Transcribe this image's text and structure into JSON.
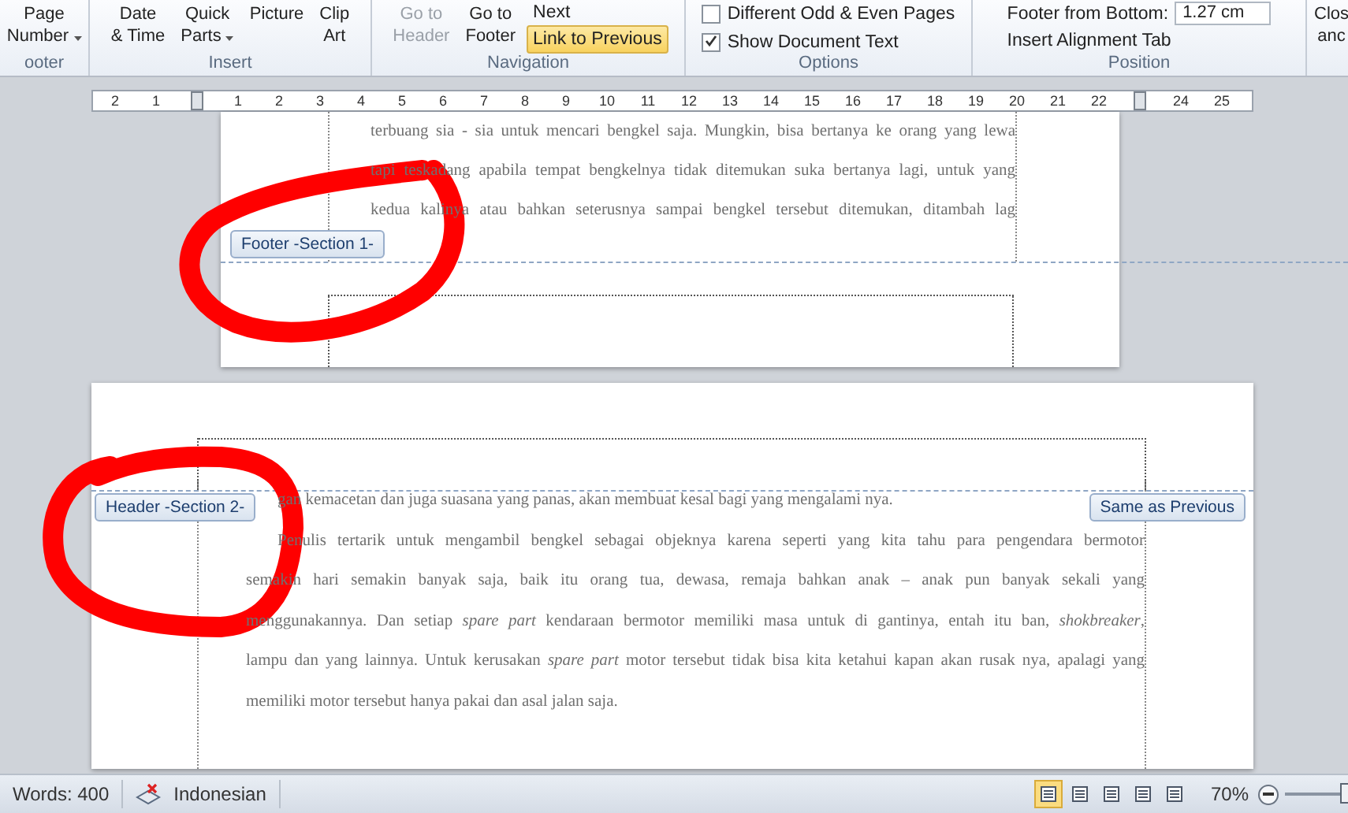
{
  "ribbon": {
    "groups": [
      {
        "label": "ooter",
        "items": [
          {
            "kind": "large",
            "lines": [
              "Page",
              "Number"
            ],
            "dropdown": true,
            "disabled": false
          }
        ]
      },
      {
        "label": "Insert",
        "items": [
          {
            "kind": "large",
            "lines": [
              "Date",
              "& Time"
            ],
            "dropdown": false,
            "disabled": false
          },
          {
            "kind": "large",
            "lines": [
              "Quick",
              "Parts"
            ],
            "dropdown": true,
            "disabled": false
          },
          {
            "kind": "large",
            "lines": [
              "Picture"
            ],
            "dropdown": false,
            "disabled": false
          },
          {
            "kind": "large",
            "lines": [
              "Clip",
              "Art"
            ],
            "dropdown": false,
            "disabled": false
          }
        ]
      },
      {
        "label": "Navigation",
        "items": [
          {
            "kind": "large",
            "lines": [
              "Go to",
              "Header"
            ],
            "dropdown": false,
            "disabled": true
          },
          {
            "kind": "large",
            "lines": [
              "Go to",
              "Footer"
            ],
            "dropdown": false,
            "disabled": false
          },
          {
            "kind": "stack",
            "rows": [
              {
                "kind": "button",
                "label": "Next",
                "selected": false
              },
              {
                "kind": "button",
                "label": "Link to Previous",
                "selected": true
              }
            ]
          }
        ]
      },
      {
        "label": "Options",
        "items": [
          {
            "kind": "stack",
            "rows": [
              {
                "kind": "checkbox",
                "label": "Different Odd & Even Pages",
                "checked": false
              },
              {
                "kind": "checkbox",
                "label": "Show Document Text",
                "checked": true
              }
            ]
          }
        ]
      },
      {
        "label": "Position",
        "items": [
          {
            "kind": "stack",
            "rows": [
              {
                "kind": "spin",
                "label": "Footer from Bottom:",
                "value": "1.27 cm"
              },
              {
                "kind": "button",
                "label": "Insert Alignment Tab",
                "selected": false
              }
            ]
          }
        ]
      },
      {
        "items": [
          {
            "kind": "large",
            "lines": [
              "Clos",
              "anc"
            ],
            "dropdown": false,
            "disabled": false
          }
        ]
      }
    ]
  },
  "ruler": {
    "cells": [
      {
        "kind": "number",
        "text": "2"
      },
      {
        "kind": "number",
        "text": "1"
      },
      {
        "kind": "marker"
      },
      {
        "kind": "number",
        "text": "1"
      },
      {
        "kind": "number",
        "text": "2"
      },
      {
        "kind": "number",
        "text": "3"
      },
      {
        "kind": "number",
        "text": "4"
      },
      {
        "kind": "number",
        "text": "5"
      },
      {
        "kind": "number",
        "text": "6"
      },
      {
        "kind": "number",
        "text": "7"
      },
      {
        "kind": "number",
        "text": "8"
      },
      {
        "kind": "number",
        "text": "9"
      },
      {
        "kind": "number",
        "text": "10"
      },
      {
        "kind": "number",
        "text": "11"
      },
      {
        "kind": "number",
        "text": "12"
      },
      {
        "kind": "number",
        "text": "13"
      },
      {
        "kind": "number",
        "text": "14"
      },
      {
        "kind": "number",
        "text": "15"
      },
      {
        "kind": "number",
        "text": "16"
      },
      {
        "kind": "number",
        "text": "17"
      },
      {
        "kind": "number",
        "text": "18"
      },
      {
        "kind": "number",
        "text": "19"
      },
      {
        "kind": "number",
        "text": "20"
      },
      {
        "kind": "number",
        "text": "21"
      },
      {
        "kind": "number",
        "text": "22"
      },
      {
        "kind": "marker"
      },
      {
        "kind": "number",
        "text": "24"
      },
      {
        "kind": "number",
        "text": "25"
      }
    ]
  },
  "page_1": {
    "lines": [
      {
        "text": "terbuang sia - sia untuk mencari bengkel saja. Mungkin, bisa bertanya ke orang yang lewa",
        "justify": true,
        "indent": false
      },
      {
        "text": "tapi teskadang apabila tempat bengkelnya tidak ditemukan suka bertanya lagi, untuk yang",
        "justify": true,
        "indent": false
      },
      {
        "text": "kedua kalinya atau bahkan seterusnya sampai bengkel tersebut ditemukan, ditambah lag",
        "justify": true,
        "indent": false
      }
    ],
    "footer_tab": "Footer -Section 1-"
  },
  "page_2": {
    "header_tab": "Header -Section 2-",
    "same_as_previous_tab": "Same as Previous",
    "lines": [
      {
        "text": "gan kemacetan dan juga suasana yang panas, akan membuat kesal bagi yang mengalami nya.",
        "justify": false,
        "indent": true
      },
      {
        "text": "Penulis tertarik untuk mengambil bengkel sebagai objeknya karena seperti yang kita tahu para pengendara bermotor",
        "justify": true,
        "indent": true
      },
      {
        "text": "semakin hari semakin banyak saja, baik itu orang tua, dewasa, remaja bahkan anak – anak pun banyak sekali yang",
        "justify": true,
        "indent": false
      },
      {
        "text": "menggunakannya. Dan setiap *spare part* kendaraan bermotor memiliki masa untuk di gantinya, entah itu ban, *shokbreaker*,",
        "justify": true,
        "indent": false
      },
      {
        "text": "lampu dan yang lainnya. Untuk kerusakan *spare part* motor tersebut tidak bisa kita ketahui kapan akan rusak nya, apalagi yang",
        "justify": true,
        "indent": false
      },
      {
        "text": "memiliki motor tersebut hanya pakai dan asal jalan saja.",
        "justify": false,
        "indent": false
      }
    ]
  },
  "status_bar": {
    "words": "Words: 400",
    "language": "Indonesian",
    "views": [
      {
        "selected": true
      },
      {
        "selected": false
      },
      {
        "selected": false
      },
      {
        "selected": false
      },
      {
        "selected": false
      }
    ],
    "zoom": "70%",
    "zoom_slider": {
      "level": 0.95
    }
  }
}
